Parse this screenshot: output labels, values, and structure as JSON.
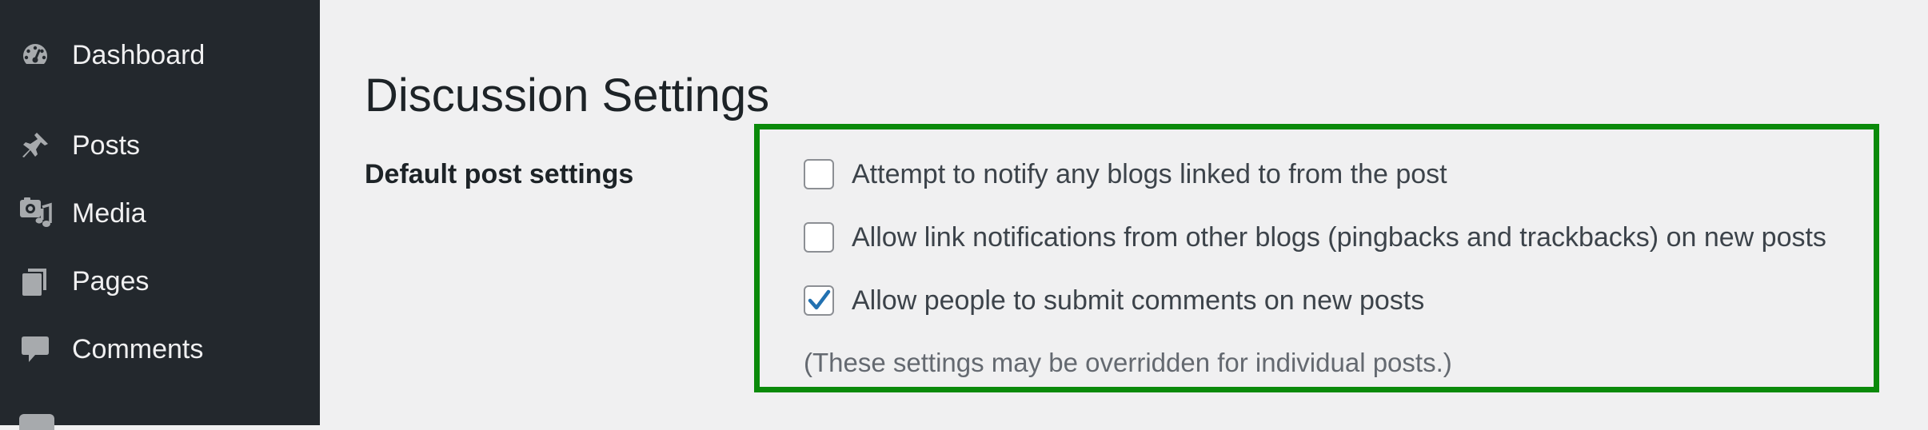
{
  "sidebar": {
    "items": [
      {
        "label": "Dashboard",
        "icon": "dashboard-icon"
      },
      {
        "label": "Posts",
        "icon": "pushpin-icon"
      },
      {
        "label": "Media",
        "icon": "media-icon"
      },
      {
        "label": "Pages",
        "icon": "pages-icon"
      },
      {
        "label": "Comments",
        "icon": "comment-icon"
      }
    ]
  },
  "main": {
    "title": "Discussion Settings",
    "section_label": "Default post settings",
    "options": [
      {
        "label": "Attempt to notify any blogs linked to from the post",
        "checked": false
      },
      {
        "label": "Allow link notifications from other blogs (pingbacks and trackbacks) on new posts",
        "checked": false
      },
      {
        "label": "Allow people to submit comments on new posts",
        "checked": true
      }
    ],
    "note": "(These settings may be overridden for individual posts.)"
  },
  "colors": {
    "sidebar_bg": "#23282d",
    "page_bg": "#f0f0f1",
    "highlight_border": "#0a8a0a",
    "checkmark": "#2271b1"
  }
}
